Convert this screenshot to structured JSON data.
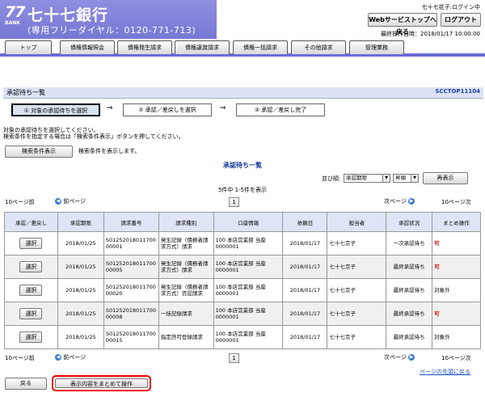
{
  "header": {
    "logo_number": "77",
    "logo_bank": "BANK",
    "bank_name": "七十七銀行",
    "dial": "(専用フリーダイヤル：0120-771-713)",
    "user_login": "七十七花子:ログイン中",
    "web_top_button": "Webサービストップへ戻る",
    "logout_button": "ログアウト",
    "last_login": "最終操作日時：2018/01/17 10:00:00"
  },
  "nav": [
    "トップ",
    "債権情報照会",
    "債権発生請求",
    "債権譲渡請求",
    "債権一括請求",
    "その他請求",
    "管理業務"
  ],
  "titlebar": {
    "title": "承認待ち一覧",
    "screen_id": "SCCTOP11104"
  },
  "steps": [
    "① 対象の承認待ちを選択",
    "② 承認／差戻しを選択",
    "③ 承認／差戻し完了"
  ],
  "step_arrow": "⇒",
  "instructions": [
    "対象の承認待ちを選択してください。",
    "検索条件を指定する場合は「検索条件表示」ボタンを押してください。"
  ],
  "search_button": "検索条件表示",
  "search_text": "検索条件を表示します。",
  "list_title": "承認待ち一覧",
  "sort": {
    "label": "並び順:",
    "field": "承認期限",
    "order": "昇順",
    "redisplay": "再表示"
  },
  "paging": {
    "info": "5件中 1-5件を表示",
    "prev10": "10ページ前",
    "prev": "前ページ",
    "page": "1",
    "next": "次ページ",
    "next10": "10ページ次"
  },
  "table": {
    "headers": [
      "承認／差戻し",
      "承認期限",
      "請求番号",
      "請求種別",
      "口座情報",
      "依頼日",
      "担当者",
      "承認状況",
      "まとめ操作"
    ],
    "select_label": "選択",
    "rows": [
      {
        "deadline": "2018/01/25",
        "number": "S01252018011700 00001",
        "type": "発生記録（債務者請求方式）請求",
        "account": "100 本店営業部 当座 0000001",
        "date": "2018/01/17",
        "person": "七十七京子",
        "status": "一次承認待ち",
        "batch": "可"
      },
      {
        "deadline": "2018/01/25",
        "number": "S01252018011700 00005",
        "type": "発生記録（債務者請求方式）請求",
        "account": "100 本店営業部 当座 0000001",
        "date": "2018/01/17",
        "person": "七十七京子",
        "status": "最終承認待ち",
        "batch": "可"
      },
      {
        "deadline": "2018/01/25",
        "number": "S01252018011700 00020",
        "type": "発生記録（債務者請求方式）否認請求",
        "account": "100 本店営業部 当座 0000001",
        "date": "2018/01/17",
        "person": "七十七京子",
        "status": "最終承認待ち",
        "batch": "対象外"
      },
      {
        "deadline": "2018/01/25",
        "number": "S01252018011700 00008",
        "type": "一括記録請求",
        "account": "100 本店営業部 当座 0000001",
        "date": "2018/01/17",
        "person": "七十七京子",
        "status": "最終承認待ち",
        "batch": "可"
      },
      {
        "deadline": "2018/01/25",
        "number": "S01252018011700 00015",
        "type": "指定許可登録請求",
        "account": "100 本店営業部 当座 0000001",
        "date": "2018/01/17",
        "person": "七十七京子",
        "status": "最終承認待ち",
        "batch": "対象外"
      }
    ]
  },
  "footer": {
    "top_link": "ページの先頭に戻る",
    "back_button": "戻る",
    "bulk_button": "表示内容をまとめて操作"
  }
}
